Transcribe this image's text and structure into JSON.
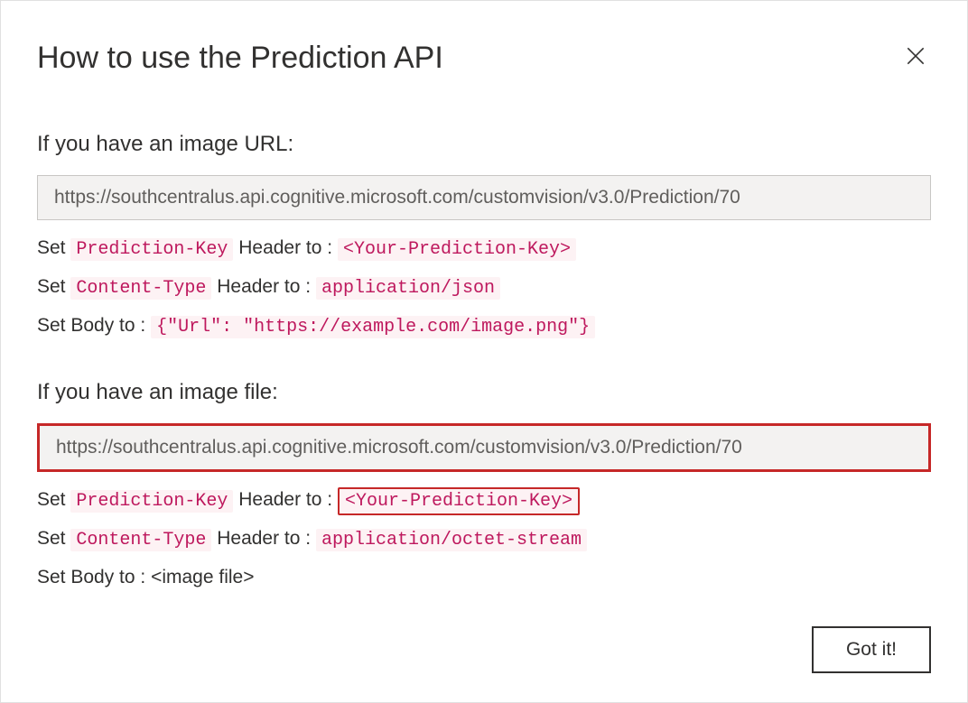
{
  "dialog": {
    "title": "How to use the Prediction API"
  },
  "section_url": {
    "heading": "If you have an image URL:",
    "endpoint": "https://southcentralus.api.cognitive.microsoft.com/customvision/v3.0/Prediction/70",
    "line1_prefix": "Set ",
    "line1_code1": "Prediction-Key",
    "line1_mid": " Header to : ",
    "line1_code2": "<Your-Prediction-Key>",
    "line2_prefix": "Set ",
    "line2_code1": "Content-Type",
    "line2_mid": " Header to : ",
    "line2_code2": "application/json",
    "line3_prefix": "Set Body to : ",
    "line3_code": "{\"Url\": \"https://example.com/image.png\"}"
  },
  "section_file": {
    "heading": "If you have an image file:",
    "endpoint": "https://southcentralus.api.cognitive.microsoft.com/customvision/v3.0/Prediction/70",
    "line1_prefix": "Set ",
    "line1_code1": "Prediction-Key",
    "line1_mid": " Header to : ",
    "line1_code2": "<Your-Prediction-Key>",
    "line2_prefix": "Set ",
    "line2_code1": "Content-Type",
    "line2_mid": " Header to : ",
    "line2_code2": "application/octet-stream",
    "line3_prefix": "Set Body to : ",
    "line3_value": "<image file>"
  },
  "footer": {
    "button_label": "Got it!"
  }
}
